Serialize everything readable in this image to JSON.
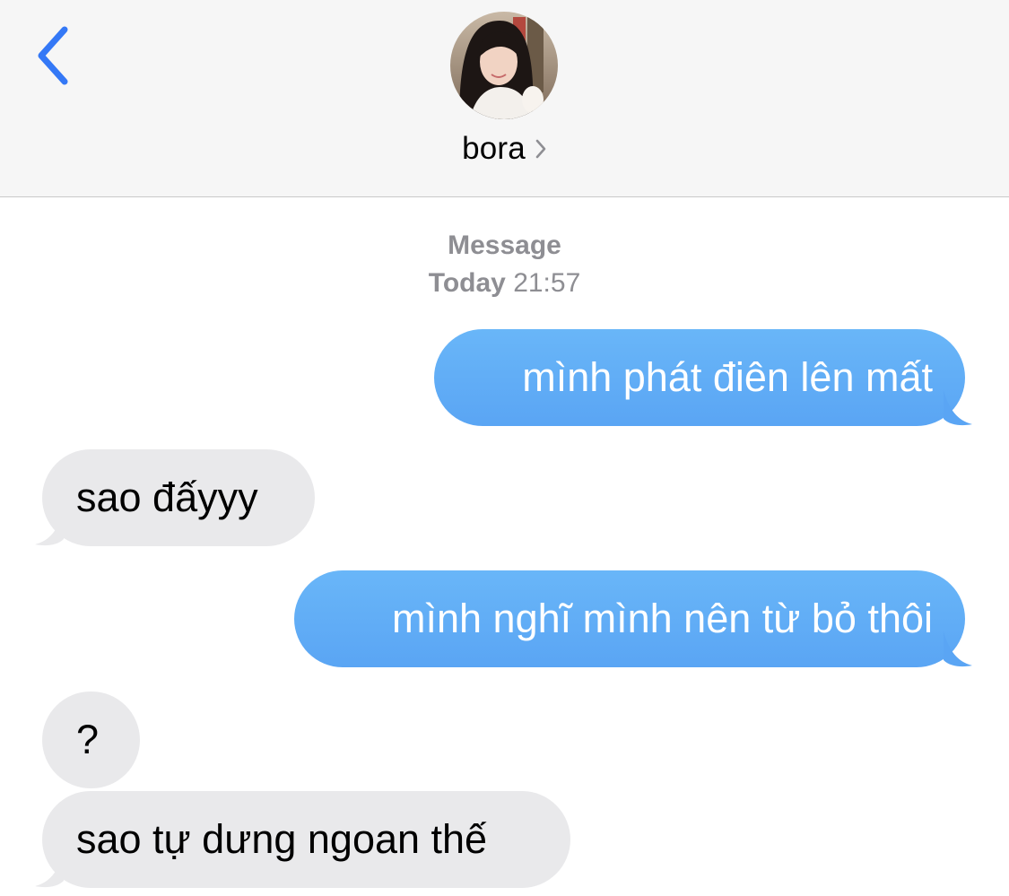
{
  "header": {
    "contact_name": "bora",
    "accent_color": "#3478f6"
  },
  "thread": {
    "service_label": "Message",
    "day_label": "Today",
    "time_label": "21:57"
  },
  "messages": [
    {
      "direction": "outgoing",
      "text": "mình phát điên lên mất"
    },
    {
      "direction": "incoming",
      "text": "sao đấyyy"
    },
    {
      "direction": "outgoing",
      "text": "mình nghĩ mình nên từ bỏ thôi"
    },
    {
      "direction": "incoming",
      "text": "?"
    },
    {
      "direction": "incoming",
      "text": "sao tự dưng ngoan thế"
    }
  ],
  "colors": {
    "outgoing_bubble": "#62aef6",
    "incoming_bubble": "#e9e9eb",
    "meta_text": "#8e8e93"
  }
}
